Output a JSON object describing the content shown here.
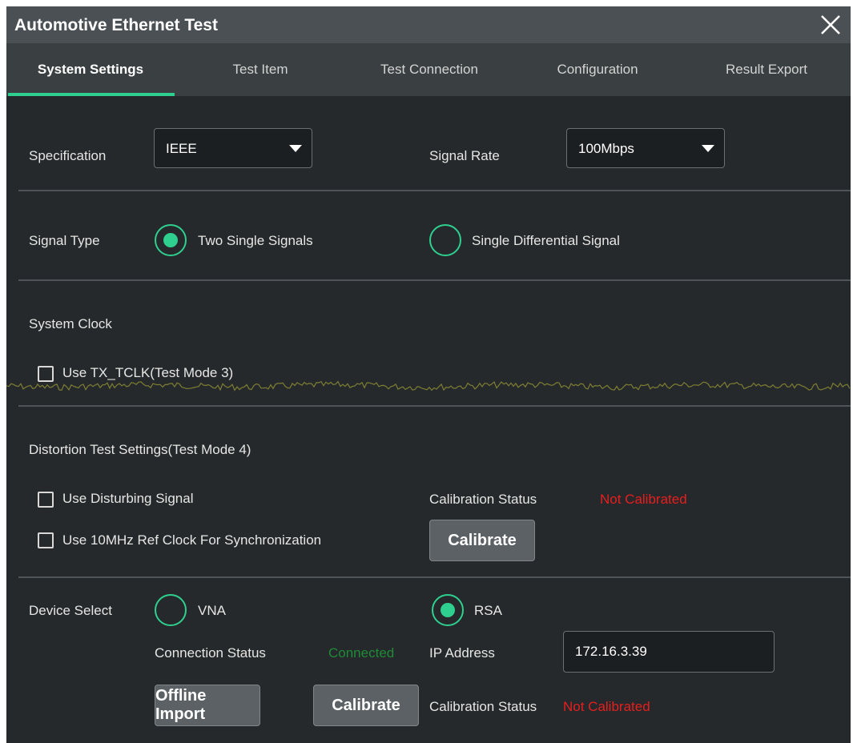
{
  "window": {
    "title": "Automotive Ethernet Test"
  },
  "tabs": [
    {
      "label": "System Settings",
      "active": true
    },
    {
      "label": "Test Item"
    },
    {
      "label": "Test Connection"
    },
    {
      "label": "Configuration"
    },
    {
      "label": "Result Export"
    }
  ],
  "specification": {
    "label": "Specification",
    "value": "IEEE"
  },
  "signal_rate": {
    "label": "Signal Rate",
    "value": "100Mbps"
  },
  "signal_type": {
    "label": "Signal Type",
    "options": [
      {
        "label": "Two Single Signals",
        "selected": true
      },
      {
        "label": "Single Differential Signal",
        "selected": false
      }
    ]
  },
  "system_clock": {
    "heading": "System Clock",
    "use_tx_tclk": {
      "label": "Use TX_TCLK(Test Mode 3)",
      "checked": false
    }
  },
  "distortion": {
    "heading": "Distortion Test Settings(Test Mode 4)",
    "use_disturbing_signal": {
      "label": "Use Disturbing Signal",
      "checked": false
    },
    "use_ref_clock": {
      "label": "Use 10MHz Ref Clock For Synchronization",
      "checked": false
    },
    "calibration_status_label": "Calibration Status",
    "calibration_status_value": "Not Calibrated",
    "calibrate_button": "Calibrate"
  },
  "device_select": {
    "label": "Device Select",
    "vna": {
      "label": "VNA",
      "selected": false
    },
    "rsa": {
      "label": "RSA",
      "selected": true
    },
    "connection_status_label": "Connection Status",
    "connection_status_value": "Connected",
    "ip_address_label": "IP Address",
    "ip_address_value": "172.16.3.39",
    "offline_import_button": "Offline Import",
    "calibrate_button": "Calibrate",
    "calibration_status_label": "Calibration Status",
    "calibration_status_value": "Not Calibrated"
  },
  "colors": {
    "accent": "#2fd08f",
    "status_error": "#e81e1e",
    "status_ok": "#1f8a37",
    "background": "#25292b",
    "trace": "#c8c23a"
  },
  "icons": {
    "close": "close-icon",
    "dropdown": "chevron-down-icon"
  }
}
